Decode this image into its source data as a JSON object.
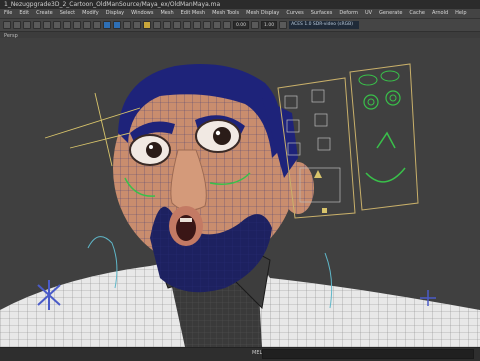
{
  "window": {
    "title": "1_Nezugpgrade3D_2_Cartoon_OldManSource/Maya_ex/OldManMaya.ma"
  },
  "menu": [
    "File",
    "Edit",
    "Create",
    "Select",
    "Modify",
    "Display",
    "Windows",
    "Mesh",
    "Edit Mesh",
    "Mesh Tools",
    "Mesh Display",
    "Curves",
    "Surfaces",
    "Deform",
    "UV",
    "Generate",
    "Cache",
    "Arnold",
    "Help"
  ],
  "toolbar": {
    "field_1": "0.00",
    "field_2": "1.00",
    "colorspace": "ACES 1.0 SDR-video (sRGB)"
  },
  "panel": {
    "label": "Persp"
  },
  "statusbar": {
    "mel_label": "MEL"
  },
  "colors": {
    "viewport_bg": "#404040",
    "wire_blue": "#2e35a8",
    "wire_green": "#39c04a",
    "wire_yellow": "#d8c46b",
    "skin": "#c98d6e",
    "hair": "#1e237a"
  }
}
